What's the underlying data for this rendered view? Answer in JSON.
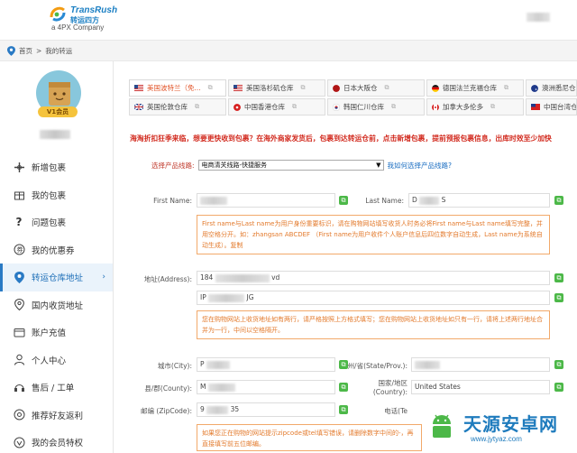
{
  "header": {
    "logo_en": "TransRush",
    "logo_cn": "转运四方",
    "logo_sub": "a 4PX Company"
  },
  "breadcrumb": {
    "home": "首页",
    "sep": ">",
    "current": "我的转运"
  },
  "sidebar": {
    "vip_label": "V1会员",
    "items": [
      {
        "label": "新增包裹",
        "icon": "plus-cross-icon"
      },
      {
        "label": "我的包裹",
        "icon": "gift-box-icon"
      },
      {
        "label": "问题包裹",
        "icon": "question-icon"
      },
      {
        "label": "我的优惠券",
        "icon": "coupon-icon"
      },
      {
        "label": "转运仓库地址",
        "icon": "location-pin-icon",
        "active": true
      },
      {
        "label": "国内收货地址",
        "icon": "location-icon"
      },
      {
        "label": "账户充值",
        "icon": "wallet-icon"
      },
      {
        "label": "个人中心",
        "icon": "user-icon"
      },
      {
        "label": "售后 / 工单",
        "icon": "headset-icon"
      },
      {
        "label": "推荐好友返利",
        "icon": "share-icon"
      },
      {
        "label": "我的会员特权",
        "icon": "vip-icon"
      }
    ]
  },
  "tabs": {
    "row1": [
      {
        "label": "美国波特兰（免...",
        "flag": "us",
        "active": true
      },
      {
        "label": "美国洛杉矶仓库",
        "flag": "us"
      },
      {
        "label": "日本大阪仓",
        "flag": "jp"
      },
      {
        "label": "德国法兰克福仓库",
        "flag": "de"
      },
      {
        "label": "澳洲悉尼仓",
        "flag": "au"
      }
    ],
    "row2": [
      {
        "label": "英国伦敦仓库",
        "flag": "uk"
      },
      {
        "label": "中国香港仓库",
        "flag": "hk"
      },
      {
        "label": "韩国仁川仓库",
        "flag": "kr"
      },
      {
        "label": "加拿大多伦多",
        "flag": "ca"
      },
      {
        "label": "中国台湾仓",
        "flag": "tw"
      }
    ]
  },
  "notice": "海淘折扣狂季来临，想要更快收到包裹？在海外商家发货后，包裹到达转运仓前，点击新增包裹，提前预报包裹信息，出库时效至少加快",
  "product_line": {
    "label": "选择产品线路:",
    "value": "电商清关线路-快捷服务",
    "link": "我如何选择产品线路?"
  },
  "form": {
    "first_name_label": "First Name:",
    "first_name_value": "",
    "last_name_label": "Last Name:",
    "last_name_value_prefix": "D",
    "last_name_value_suffix": "S",
    "name_tip": "First name与Last name为用户身份重要标识，请在购物网站填写收货人时务必将First name与Last name填写完整，并用空格分开。如：zhangsan ABCDEF （First name为用户收件个人账户信息后四位数字自动生成，Last name为系统自动生成）。复制",
    "address_label": "地址(Address):",
    "address1_prefix": "184",
    "address1_suffix": "vd",
    "address2_prefix": "IP",
    "address2_suffix": "JG",
    "address_tip": "您在购物网站上收货地址如有两行，请严格按照上方格式填写；您在购物网站上收货地址如只有一行，请将上述两行地址合并为一行，中间以空格隔开。",
    "city_label": "城市(City):",
    "city_prefix": "P",
    "state_label": "州/省(State/Prov.):",
    "county_label": "县/郡(County):",
    "county_prefix": "M",
    "country_label": "国家/地区\n(Country):",
    "country_value": "United States",
    "zip_label": "邮编 (ZipCode):",
    "zip_prefix": "9",
    "zip_suffix": "35",
    "phone_label": "电话(Te",
    "zip_tip": "如果您正在购物的网站提示zipcode或tel填写错误，请删除数字中间的-，再直接填写前五位邮编。"
  },
  "watermark": {
    "text": "天源安卓网",
    "url": "www.jytyaz.com"
  },
  "colors": {
    "accent": "#1e6fb8",
    "warning": "#d22b1f",
    "tip": "#e37a2c",
    "success": "#4cb848"
  }
}
